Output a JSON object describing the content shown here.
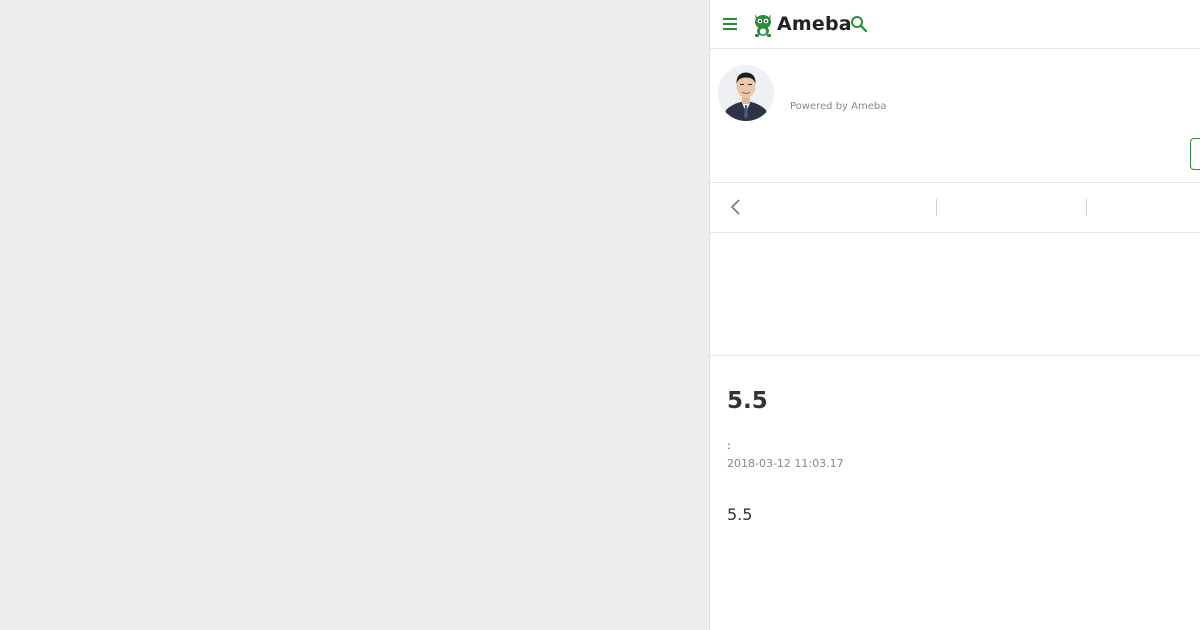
{
  "header": {
    "logo_text": "Ameba",
    "brand_color": "#2d8c3c",
    "icons": [
      "menu-icon",
      "search-icon"
    ]
  },
  "blog": {
    "title": "",
    "powered_by": "Powered by Ameba",
    "avatar": "politician-portrait"
  },
  "nav": {
    "back_icon": "chevron-left-icon"
  },
  "entry": {
    "title": "5.5",
    "theme": ":",
    "date": "2018-03-12 11:03.17",
    "body": "5.5"
  }
}
